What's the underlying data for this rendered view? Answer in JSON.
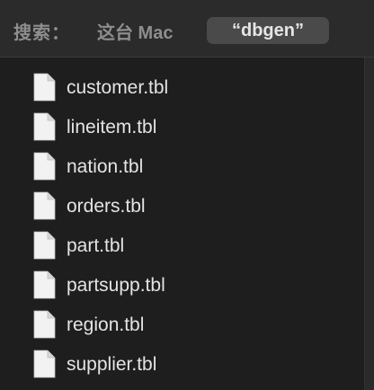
{
  "search": {
    "label": "搜索：",
    "scopes": [
      {
        "label": "这台 Mac",
        "selected": false
      },
      {
        "label": "“dbgen”",
        "selected": true
      }
    ]
  },
  "files": [
    {
      "name": "customer.tbl",
      "icon": "document-icon"
    },
    {
      "name": "lineitem.tbl",
      "icon": "document-icon"
    },
    {
      "name": "nation.tbl",
      "icon": "document-icon"
    },
    {
      "name": "orders.tbl",
      "icon": "document-icon"
    },
    {
      "name": "part.tbl",
      "icon": "document-icon"
    },
    {
      "name": "partsupp.tbl",
      "icon": "document-icon"
    },
    {
      "name": "region.tbl",
      "icon": "document-icon"
    },
    {
      "name": "supplier.tbl",
      "icon": "document-icon"
    }
  ],
  "colors": {
    "background": "#1e1e1e",
    "toolbar": "#2b2b2b",
    "selected_scope": "#4a4a4a",
    "text": "#e4e4e4",
    "muted_text": "#8e8e8e"
  }
}
